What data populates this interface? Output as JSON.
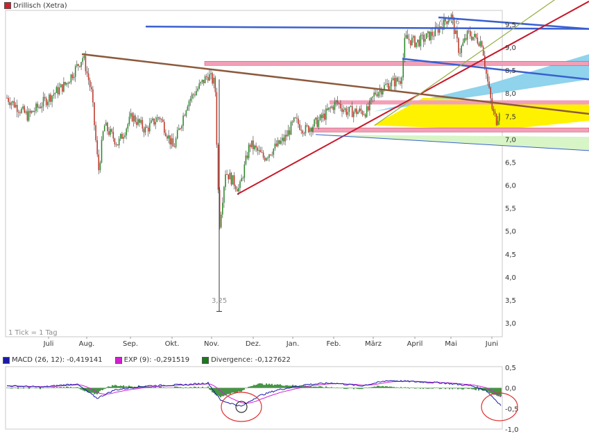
{
  "header": {
    "title": "Drillisch (Xetra)",
    "title_color": "#d0202a"
  },
  "footer_note": "1 Tick = 1 Tag",
  "chart_data": [
    {
      "type": "candlestick",
      "title": "Drillisch (Xetra)",
      "y_axis_side": "right",
      "ylim": [
        2.75,
        10.25
      ],
      "yticks": [
        "3,0",
        "3,5",
        "4,0",
        "4,5",
        "5,0",
        "5,5",
        "6,0",
        "6,5",
        "7,0",
        "7,5",
        "8,0",
        "8,5",
        "9,0",
        "9,5"
      ],
      "xticks": [
        "Juli",
        "Aug.",
        "Sep.",
        "Okt.",
        "Nov.",
        "Dez.",
        "Jan.",
        "Feb.",
        "März",
        "April",
        "Mai",
        "Juni"
      ],
      "annotations": [
        {
          "text": "9,746",
          "x": "Apr. (Ende)",
          "y": 9.746
        },
        {
          "text": "3,25",
          "x": "Nov. (Anfang)",
          "y": 3.25
        }
      ],
      "series": [
        {
          "x": "Juli",
          "y": 7.8
        },
        {
          "x": "Aug.",
          "y": 8.8
        },
        {
          "x": "Sep.",
          "y": 7.1
        },
        {
          "x": "Okt.",
          "y": 7.3
        },
        {
          "x": "Nov.",
          "y": 8.1
        },
        {
          "x": "Nov.",
          "y": 3.25
        },
        {
          "x": "Dez.",
          "y": 6.5
        },
        {
          "x": "Jan.",
          "y": 7.1
        },
        {
          "x": "Feb.",
          "y": 7.7
        },
        {
          "x": "März",
          "y": 7.8
        },
        {
          "x": "April",
          "y": 9.0
        },
        {
          "x": "Mai",
          "y": 9.6
        },
        {
          "x": "Juni",
          "y": 7.6
        }
      ],
      "colors": {
        "up": "#2e8b2e",
        "down": "#c0392b",
        "trend_red": "#c8182a",
        "trend_blue": "#3a5fd0",
        "trend_brown": "#8b5a3c",
        "trend_olive": "#9ab24a",
        "band_pink": "#f2a0b8",
        "fill_yellow": "#fff200",
        "fill_lightblue": "#8fd3ec",
        "fill_lightgreen": "#d7f5c6"
      }
    },
    {
      "type": "line",
      "ylim": [
        -1.0,
        0.5
      ],
      "yticks": [
        "0,5",
        "0,0",
        "-0,5",
        "-1,0"
      ],
      "legend": [
        {
          "label": "MACD (26, 12): -0,419141",
          "color": "#1a1aa8"
        },
        {
          "label": "EXP (9): -0,291519",
          "color": "#d020d0"
        },
        {
          "label": "Divergence: -0,127622",
          "color": "#1a7a1a"
        }
      ]
    }
  ]
}
